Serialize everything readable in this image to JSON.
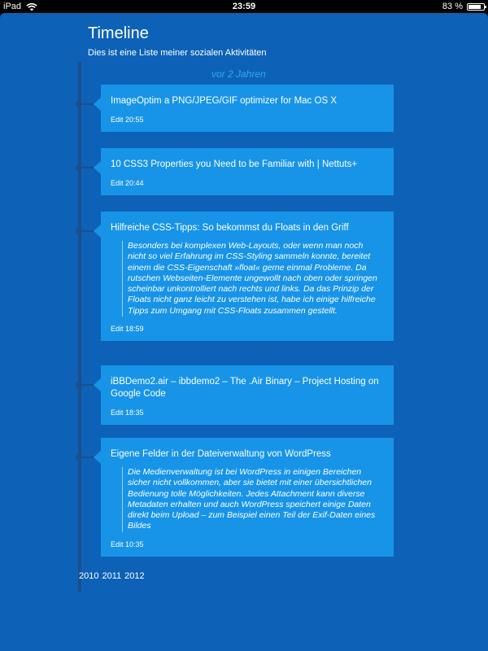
{
  "statusbar": {
    "device": "iPad",
    "time": "23:59",
    "battery_text": "83 %",
    "battery_level": 0.83
  },
  "page": {
    "title": "Timeline",
    "subtitle": "Dies ist eine Liste meiner sozialen Aktivitäten",
    "period_label": "vor 2 Jahren"
  },
  "entries": [
    {
      "title": "ImageOptim a PNG/JPEG/GIF optimizer for Mac OS X",
      "quote": "",
      "edit_label": "Edit",
      "time": "20:55"
    },
    {
      "title": "10 CSS3 Properties you Need to be Familiar with | Nettuts+",
      "quote": "",
      "edit_label": "Edit",
      "time": "20:44"
    },
    {
      "title": "Hilfreiche CSS-Tipps: So bekommst du Floats in den Griff",
      "quote": "Besonders bei komplexen Web-Layouts, oder wenn man noch nicht so viel Erfahrung im CSS-Styling sammeln konnte, bereitet einem die CSS-Eigenschaft »float« gerne einmal Probleme. Da rutschen Webseiten-Elemente ungewollt nach oben oder springen scheinbar unkontrolliert nach rechts und links. Da das Prinzip der Floats nicht ganz leicht zu verstehen ist, habe ich einige hilfreiche Tipps zum Umgang mit CSS-Floats zusammen gestellt.",
      "edit_label": "Edit",
      "time": "18:59"
    },
    {
      "title": "iBBDemo2.air – ibbdemo2 – The .Air Binary – Project Hosting on Google Code",
      "quote": "",
      "edit_label": "Edit",
      "time": "18:35"
    },
    {
      "title": "Eigene Felder in der Dateiverwaltung von WordPress",
      "quote": "Die Medienverwaltung ist bei WordPress in einigen Bereichen sicher nicht vollkommen, aber sie bietet mit einer übersichtlichen Bedienung tolle Möglichkeiten. Jedes Attachment kann diverse Metadaten erhalten und auch WordPress speichert einige Daten direkt beim Upload – zum Beispiel einen Teil der Exif-Daten eines Bildes",
      "edit_label": "Edit",
      "time": "10:35"
    }
  ],
  "years": [
    "2010",
    "2011",
    "2012"
  ]
}
